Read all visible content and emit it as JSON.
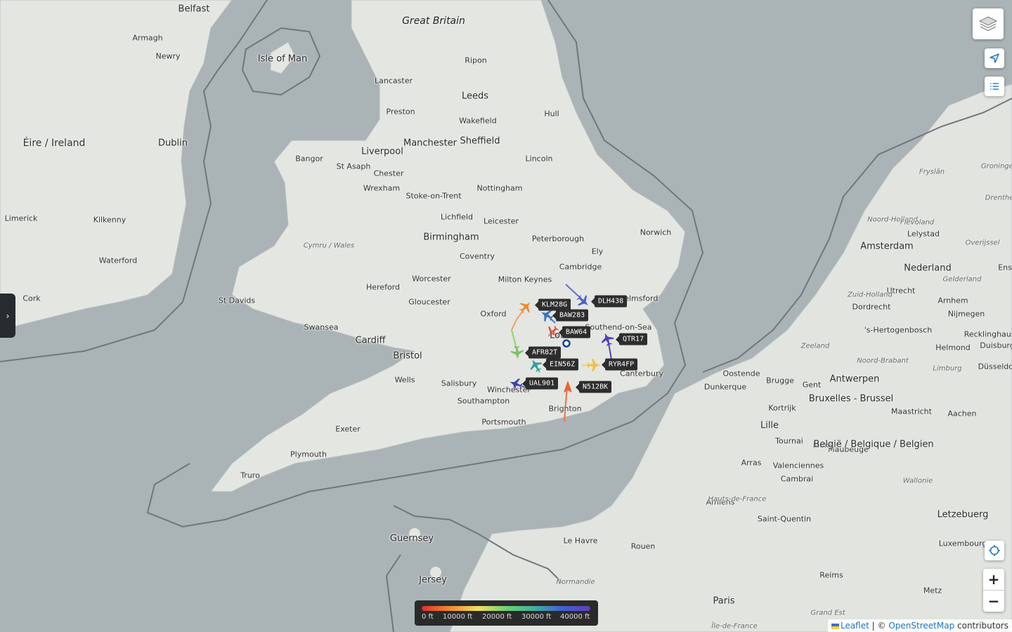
{
  "map": {
    "region": "Great Britain",
    "places": [
      {
        "name": "Belfast"
      },
      {
        "name": "Great Britain"
      },
      {
        "name": "Isle of Man"
      },
      {
        "name": "Armagh"
      },
      {
        "name": "Newry"
      },
      {
        "name": "Ripon"
      },
      {
        "name": "Lancaster"
      },
      {
        "name": "Leeds"
      },
      {
        "name": "Preston"
      },
      {
        "name": "Wakefield"
      },
      {
        "name": "Hull"
      },
      {
        "name": "Éire / Ireland"
      },
      {
        "name": "Dublin"
      },
      {
        "name": "Manchester"
      },
      {
        "name": "Sheffield"
      },
      {
        "name": "Liverpool"
      },
      {
        "name": "Bangor"
      },
      {
        "name": "St Asaph"
      },
      {
        "name": "Chester"
      },
      {
        "name": "Wrexham"
      },
      {
        "name": "Lincoln"
      },
      {
        "name": "Nottingham"
      },
      {
        "name": "Stoke-on-Trent"
      },
      {
        "name": "Lichfield"
      },
      {
        "name": "Leicester"
      },
      {
        "name": "Limerick"
      },
      {
        "name": "Kilkenny"
      },
      {
        "name": "Birmingham"
      },
      {
        "name": "Cymru / Wales"
      },
      {
        "name": "Peterborough"
      },
      {
        "name": "Norwich"
      },
      {
        "name": "Waterford"
      },
      {
        "name": "Coventry"
      },
      {
        "name": "Ely"
      },
      {
        "name": "Cambridge"
      },
      {
        "name": "Milton Keynes"
      },
      {
        "name": "Worcester"
      },
      {
        "name": "Cork"
      },
      {
        "name": "Hereford"
      },
      {
        "name": "Gloucester"
      },
      {
        "name": "St Davids"
      },
      {
        "name": "Oxford"
      },
      {
        "name": "Chelmsford"
      },
      {
        "name": "Swansea"
      },
      {
        "name": "Southend-on-Sea"
      },
      {
        "name": "Cardiff"
      },
      {
        "name": "London"
      },
      {
        "name": "Bristol"
      },
      {
        "name": "Wells"
      },
      {
        "name": "Salisbury"
      },
      {
        "name": "Winchester"
      },
      {
        "name": "Canterbury"
      },
      {
        "name": "Southampton"
      },
      {
        "name": "Brighton"
      },
      {
        "name": "Portsmouth"
      },
      {
        "name": "Exeter"
      },
      {
        "name": "Plymouth"
      },
      {
        "name": "Truro"
      },
      {
        "name": "Guernsey"
      },
      {
        "name": "Jersey"
      },
      {
        "name": "Le Havre"
      },
      {
        "name": "Rouen"
      },
      {
        "name": "Normandie"
      },
      {
        "name": "Paris"
      },
      {
        "name": "Île-de-France"
      },
      {
        "name": "Amiens"
      },
      {
        "name": "Hauts-de-France"
      },
      {
        "name": "Saint-Quentin"
      },
      {
        "name": "Reims"
      },
      {
        "name": "Grand Est"
      },
      {
        "name": "Metz"
      },
      {
        "name": "Luxembourg"
      },
      {
        "name": "Letzebuerg"
      },
      {
        "name": "Arras"
      },
      {
        "name": "Cambrai"
      },
      {
        "name": "Valenciennes"
      },
      {
        "name": "Maubeuge"
      },
      {
        "name": "Wallonie"
      },
      {
        "name": "Lille"
      },
      {
        "name": "Tournai"
      },
      {
        "name": "Kortrijk"
      },
      {
        "name": "Mons"
      },
      {
        "name": "Dunkerque"
      },
      {
        "name": "Oostende"
      },
      {
        "name": "Brugge"
      },
      {
        "name": "Gent"
      },
      {
        "name": "Antwerpen"
      },
      {
        "name": "Bruxelles - Brussel"
      },
      {
        "name": "België / Belgique / Belgien"
      },
      {
        "name": "Maastricht"
      },
      {
        "name": "Aachen"
      },
      {
        "name": "Zeeland"
      },
      {
        "name": "Noord-Brabant"
      },
      {
        "name": "Limburg"
      },
      {
        "name": "Nederland"
      },
      {
        "name": "Utrecht"
      },
      {
        "name": "Arnhem"
      },
      {
        "name": "Nijmegen"
      },
      {
        "name": "'s-Hertogenbosch"
      },
      {
        "name": "Dordrecht"
      },
      {
        "name": "Zuid-Holland"
      },
      {
        "name": "Amsterdam"
      },
      {
        "name": "Noord-Holland"
      },
      {
        "name": "Lelystad"
      },
      {
        "name": "Flevoland"
      },
      {
        "name": "Gelderland"
      },
      {
        "name": "Overijssel"
      },
      {
        "name": "Fryslân"
      },
      {
        "name": "Groningen"
      },
      {
        "name": "Drenthe"
      },
      {
        "name": "Helmond"
      },
      {
        "name": "Recklinghausen"
      },
      {
        "name": "Duisburg"
      },
      {
        "name": "Düsseldorf"
      },
      {
        "name": "Ens"
      }
    ]
  },
  "flights": [
    {
      "callsign": "KLM28G",
      "color": "#f08a30"
    },
    {
      "callsign": "DLH438",
      "color": "#5060c8"
    },
    {
      "callsign": "BAW283",
      "color": "#3a70c8"
    },
    {
      "callsign": "BAW64",
      "color": "#e04a3a"
    },
    {
      "callsign": "QTR17",
      "color": "#5040b8"
    },
    {
      "callsign": "AFR82T",
      "color": "#80c060"
    },
    {
      "callsign": "EIN56Z",
      "color": "#30a0a0"
    },
    {
      "callsign": "RYR4FP",
      "color": "#f0c040"
    },
    {
      "callsign": "UAL901",
      "color": "#4040b0"
    },
    {
      "callsign": "N512BK",
      "color": "#f06030"
    }
  ],
  "legend": {
    "labels": [
      "0 ft",
      "10000 ft",
      "20000 ft",
      "30000 ft",
      "40000 ft"
    ]
  },
  "attribution": {
    "leaflet": "Leaflet",
    "sep": "| ©",
    "osm": "OpenStreetMap",
    "contributors": "contributors"
  },
  "icons": [
    "layers-icon",
    "locate-arrow-icon",
    "list-icon",
    "crosshair-icon",
    "chevron-right-icon",
    "plane-icon"
  ],
  "colors": {
    "sea": "#aab3b5",
    "land": "#e6e8e3",
    "sidebar": "#262b30",
    "label_bg": "#2d2d2d"
  }
}
